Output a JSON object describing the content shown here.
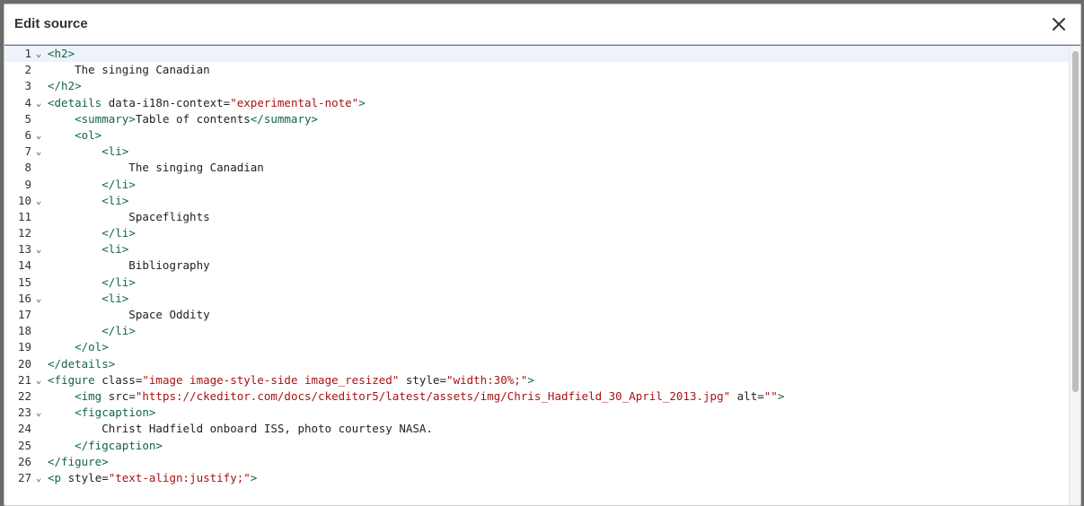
{
  "dialog": {
    "title": "Edit source",
    "close_icon": "close-icon"
  },
  "editor": {
    "active_line": 1,
    "lines": [
      {
        "n": "1",
        "fold": true,
        "segs": [
          {
            "c": "t",
            "v": "<h2>"
          }
        ]
      },
      {
        "n": "2",
        "fold": false,
        "segs": [
          {
            "c": "",
            "v": "    The singing Canadian"
          }
        ]
      },
      {
        "n": "3",
        "fold": false,
        "segs": [
          {
            "c": "t",
            "v": "</h2>"
          }
        ]
      },
      {
        "n": "4",
        "fold": true,
        "segs": [
          {
            "c": "t",
            "v": "<details"
          },
          {
            "c": "",
            "v": " data-i18n-context="
          },
          {
            "c": "s",
            "v": "\"experimental-note\""
          },
          {
            "c": "t",
            "v": ">"
          }
        ]
      },
      {
        "n": "5",
        "fold": false,
        "segs": [
          {
            "c": "",
            "v": "    "
          },
          {
            "c": "t",
            "v": "<summary>"
          },
          {
            "c": "",
            "v": "Table of contents"
          },
          {
            "c": "t",
            "v": "</summary>"
          }
        ]
      },
      {
        "n": "6",
        "fold": true,
        "segs": [
          {
            "c": "",
            "v": "    "
          },
          {
            "c": "t",
            "v": "<ol>"
          }
        ]
      },
      {
        "n": "7",
        "fold": true,
        "segs": [
          {
            "c": "",
            "v": "        "
          },
          {
            "c": "t",
            "v": "<li>"
          }
        ]
      },
      {
        "n": "8",
        "fold": false,
        "segs": [
          {
            "c": "",
            "v": "            The singing Canadian"
          }
        ]
      },
      {
        "n": "9",
        "fold": false,
        "segs": [
          {
            "c": "",
            "v": "        "
          },
          {
            "c": "t",
            "v": "</li>"
          }
        ]
      },
      {
        "n": "10",
        "fold": true,
        "segs": [
          {
            "c": "",
            "v": "        "
          },
          {
            "c": "t",
            "v": "<li>"
          }
        ]
      },
      {
        "n": "11",
        "fold": false,
        "segs": [
          {
            "c": "",
            "v": "            Spaceflights"
          }
        ]
      },
      {
        "n": "12",
        "fold": false,
        "segs": [
          {
            "c": "",
            "v": "        "
          },
          {
            "c": "t",
            "v": "</li>"
          }
        ]
      },
      {
        "n": "13",
        "fold": true,
        "segs": [
          {
            "c": "",
            "v": "        "
          },
          {
            "c": "t",
            "v": "<li>"
          }
        ]
      },
      {
        "n": "14",
        "fold": false,
        "segs": [
          {
            "c": "",
            "v": "            Bibliography"
          }
        ]
      },
      {
        "n": "15",
        "fold": false,
        "segs": [
          {
            "c": "",
            "v": "        "
          },
          {
            "c": "t",
            "v": "</li>"
          }
        ]
      },
      {
        "n": "16",
        "fold": true,
        "segs": [
          {
            "c": "",
            "v": "        "
          },
          {
            "c": "t",
            "v": "<li>"
          }
        ]
      },
      {
        "n": "17",
        "fold": false,
        "segs": [
          {
            "c": "",
            "v": "            Space Oddity"
          }
        ]
      },
      {
        "n": "18",
        "fold": false,
        "segs": [
          {
            "c": "",
            "v": "        "
          },
          {
            "c": "t",
            "v": "</li>"
          }
        ]
      },
      {
        "n": "19",
        "fold": false,
        "segs": [
          {
            "c": "",
            "v": "    "
          },
          {
            "c": "t",
            "v": "</ol>"
          }
        ]
      },
      {
        "n": "20",
        "fold": false,
        "segs": [
          {
            "c": "t",
            "v": "</details>"
          }
        ]
      },
      {
        "n": "21",
        "fold": true,
        "segs": [
          {
            "c": "t",
            "v": "<figure"
          },
          {
            "c": "",
            "v": " class="
          },
          {
            "c": "s",
            "v": "\"image image-style-side image_resized\""
          },
          {
            "c": "",
            "v": " style="
          },
          {
            "c": "s",
            "v": "\"width:30%;\""
          },
          {
            "c": "t",
            "v": ">"
          }
        ]
      },
      {
        "n": "22",
        "fold": false,
        "segs": [
          {
            "c": "",
            "v": "    "
          },
          {
            "c": "t",
            "v": "<img"
          },
          {
            "c": "",
            "v": " src="
          },
          {
            "c": "s",
            "v": "\"https://ckeditor.com/docs/ckeditor5/latest/assets/img/Chris_Hadfield_30_April_2013.jpg\""
          },
          {
            "c": "",
            "v": " alt="
          },
          {
            "c": "s",
            "v": "\"\""
          },
          {
            "c": "t",
            "v": ">"
          }
        ]
      },
      {
        "n": "23",
        "fold": true,
        "segs": [
          {
            "c": "",
            "v": "    "
          },
          {
            "c": "t",
            "v": "<figcaption>"
          }
        ]
      },
      {
        "n": "24",
        "fold": false,
        "segs": [
          {
            "c": "",
            "v": "        Christ Hadfield onboard ISS, photo courtesy NASA."
          }
        ]
      },
      {
        "n": "25",
        "fold": false,
        "segs": [
          {
            "c": "",
            "v": "    "
          },
          {
            "c": "t",
            "v": "</figcaption>"
          }
        ]
      },
      {
        "n": "26",
        "fold": false,
        "segs": [
          {
            "c": "t",
            "v": "</figure>"
          }
        ]
      },
      {
        "n": "27",
        "fold": true,
        "segs": [
          {
            "c": "t",
            "v": "<p"
          },
          {
            "c": "",
            "v": " style="
          },
          {
            "c": "s",
            "v": "\"text-align:justify;\""
          },
          {
            "c": "t",
            "v": ">"
          }
        ]
      }
    ]
  }
}
